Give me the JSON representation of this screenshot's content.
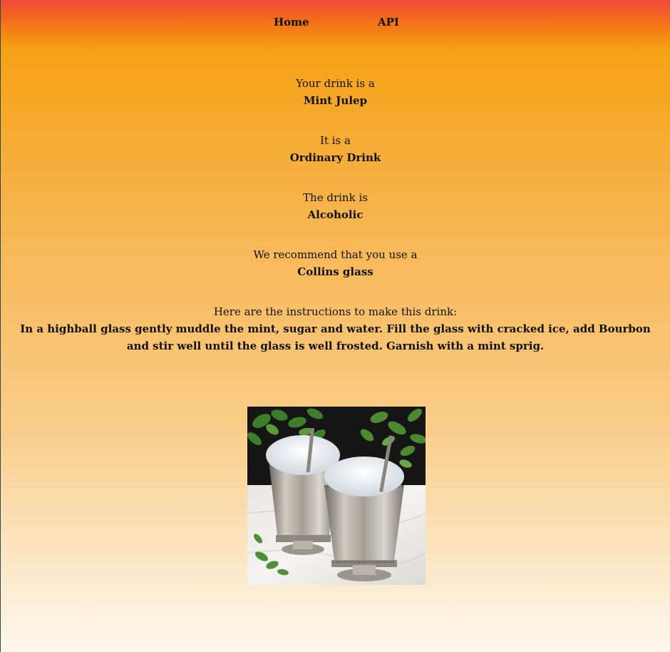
{
  "nav": {
    "home_label": "Home",
    "api_label": "API"
  },
  "drink": {
    "name_label": "Your drink is a",
    "name": "Mint Julep",
    "category_label": "It is a",
    "category": "Ordinary Drink",
    "alcoholic_label": "The drink is",
    "alcoholic": "Alcoholic",
    "glass_label": "We recommend that you use a",
    "glass": "Collins glass",
    "instructions_label": "Here are the instructions to make this drink:",
    "instructions": "In a highball glass gently muddle the mint, sugar and water. Fill the glass with cracked ice, add Bourbon and stir well until the glass is well frosted. Garnish with a mint sprig."
  },
  "image": {
    "subject": "two silver julep cups with crushed ice, mint sprigs and straws"
  }
}
